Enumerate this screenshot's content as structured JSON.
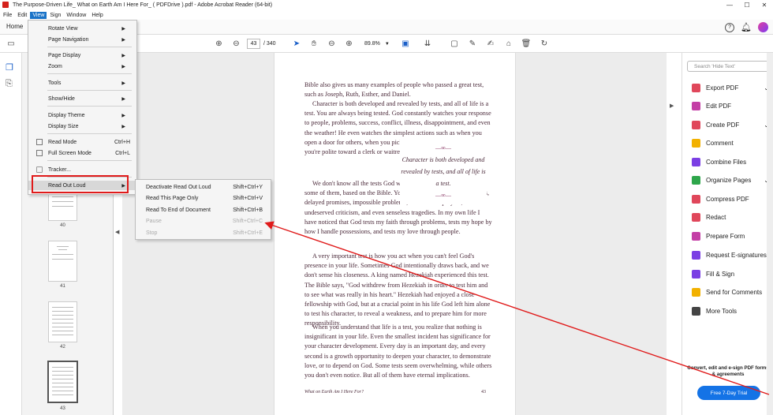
{
  "window": {
    "title": "The Purpose-Driven Life_ What on Earth Am I Here For_ ( PDFDrive ).pdf - Adobe Acrobat Reader (64-bit)",
    "minimize": "—",
    "maximize": "☐",
    "close": "✕"
  },
  "menubar": [
    "File",
    "Edit",
    "View",
    "Sign",
    "Window",
    "Help"
  ],
  "tabs": {
    "home": "Home"
  },
  "toolbar": {
    "current_page": "43",
    "total_pages": "/ 340",
    "zoom": "89.8%"
  },
  "view_menu": {
    "items": [
      {
        "label": "Rotate View",
        "submenu": true
      },
      {
        "label": "Page Navigation",
        "submenu": true
      },
      {
        "label": "Page Display",
        "submenu": true
      },
      {
        "label": "Zoom",
        "submenu": true
      },
      {
        "label": "Tools",
        "submenu": true
      },
      {
        "label": "Show/Hide",
        "submenu": true
      },
      {
        "label": "Display Theme",
        "submenu": true
      },
      {
        "label": "Display Size",
        "submenu": true
      },
      {
        "label": "Read Mode",
        "shortcut": "Ctrl+H"
      },
      {
        "label": "Full Screen Mode",
        "shortcut": "Ctrl+L"
      },
      {
        "label": "Tracker..."
      },
      {
        "label": "Read Out Loud",
        "submenu": true
      }
    ]
  },
  "read_out_loud_menu": [
    {
      "label": "Deactivate Read Out Loud",
      "shortcut": "Shift+Ctrl+Y"
    },
    {
      "label": "Read This Page Only",
      "shortcut": "Shift+Ctrl+V"
    },
    {
      "label": "Read To End of Document",
      "shortcut": "Shift+Ctrl+B"
    },
    {
      "label": "Pause",
      "shortcut": "Shift+Ctrl+C",
      "disabled": true
    },
    {
      "label": "Stop",
      "shortcut": "Shift+Ctrl+E",
      "disabled": true
    }
  ],
  "thumbnails": [
    "40",
    "41",
    "42",
    "43"
  ],
  "page_text": {
    "p1": "Bible also gives us many examples of people who passed a great test, such as Joseph, Ruth, Esther, and Daniel.",
    "p2": "Character is both developed and revealed by tests, and all of life is a test. You are always being tested. God constantly watches your response to people, problems, success, conflict, illness, disappointment, and even the weather! He even watches the simplest actions such as when you open a door for others, when you pick up a piece of trash, or when you're polite toward a clerk or waitress.",
    "p3": "We don't know all the tests God will give you, but we can predict some of them, based on the Bible. You will be tested by major changes, delayed promises, impossible problems, unanswered prayers, undeserved criticism, and even senseless tragedies. In my own life I have noticed that God tests my faith through problems, tests my hope by how I handle possessions, and tests my love through people.",
    "p4": "A very important test is how you act when you can't feel God's presence in your life. Sometimes God intentionally draws back, and we don't sense his closeness. A king named Hezekiah experienced this test. The Bible says, \"God withdrew from Hezekiah in order to test him and to see what was really in his heart.\" Hezekiah had enjoyed a close fellowship with God, but at a crucial point in his life God left him alone to test his character, to reveal a weakness, and to prepare him for more responsibility.",
    "p5": "When you understand that life is a test, you realize that nothing is insignificant in your life. Even the smallest incident has significance for your character development. Every day is an important day, and every second is a growth opportunity to deepen your character, to demonstrate love, or to depend on God. Some tests seem overwhelming, while others you don't even notice. But all of them have eternal implications.",
    "pullquote": "Character is both developed and revealed by tests, and all of life is a test.",
    "footer_title": "What on Earth Am I Here For?",
    "footer_page": "43"
  },
  "right_panel": {
    "search_placeholder": "Search 'Hide Text'",
    "tools": [
      {
        "label": "Export PDF",
        "color": "#e0475b",
        "expand": true
      },
      {
        "label": "Edit PDF",
        "color": "#c43fa6"
      },
      {
        "label": "Create PDF",
        "color": "#e0475b",
        "expand": true
      },
      {
        "label": "Comment",
        "color": "#f2b100"
      },
      {
        "label": "Combine Files",
        "color": "#7b3fe4"
      },
      {
        "label": "Organize Pages",
        "color": "#2ea64b",
        "expand": true
      },
      {
        "label": "Compress PDF",
        "color": "#e0475b"
      },
      {
        "label": "Redact",
        "color": "#e0475b"
      },
      {
        "label": "Prepare Form",
        "color": "#c43fa6"
      },
      {
        "label": "Request E-signatures",
        "color": "#7b3fe4"
      },
      {
        "label": "Fill & Sign",
        "color": "#7b3fe4"
      },
      {
        "label": "Send for Comments",
        "color": "#f2b100"
      },
      {
        "label": "More Tools",
        "color": "#444444"
      }
    ],
    "promo": "Convert, edit and e-sign PDF forms & agreements",
    "trial_button": "Free 7-Day Trial"
  }
}
